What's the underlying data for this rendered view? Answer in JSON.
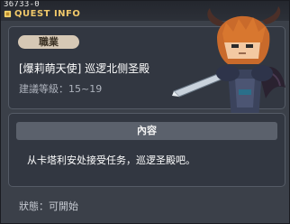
{
  "quest_id": "36733-0",
  "header_title": "QUEST INFO",
  "job_label": "職業",
  "quest_name": "[爆莉萌天使] 巡逻北侧圣殿",
  "recommended_level_label": "建議等級：",
  "recommended_level_value": "15~19",
  "content_header": "內容",
  "content_text": "从卡塔利安处接受任务，巡逻圣殿吧。",
  "status_label": "狀態：",
  "status_value": "可開始",
  "colors": {
    "window_bg": "#3b4049",
    "panel_bg": "#323741",
    "header_title": "#f0c86a",
    "job_badge": "#d6c8b5",
    "section_header": "#5b616c"
  },
  "icons": [
    "quest-marker-icon",
    "kaiser-character-illustration"
  ]
}
